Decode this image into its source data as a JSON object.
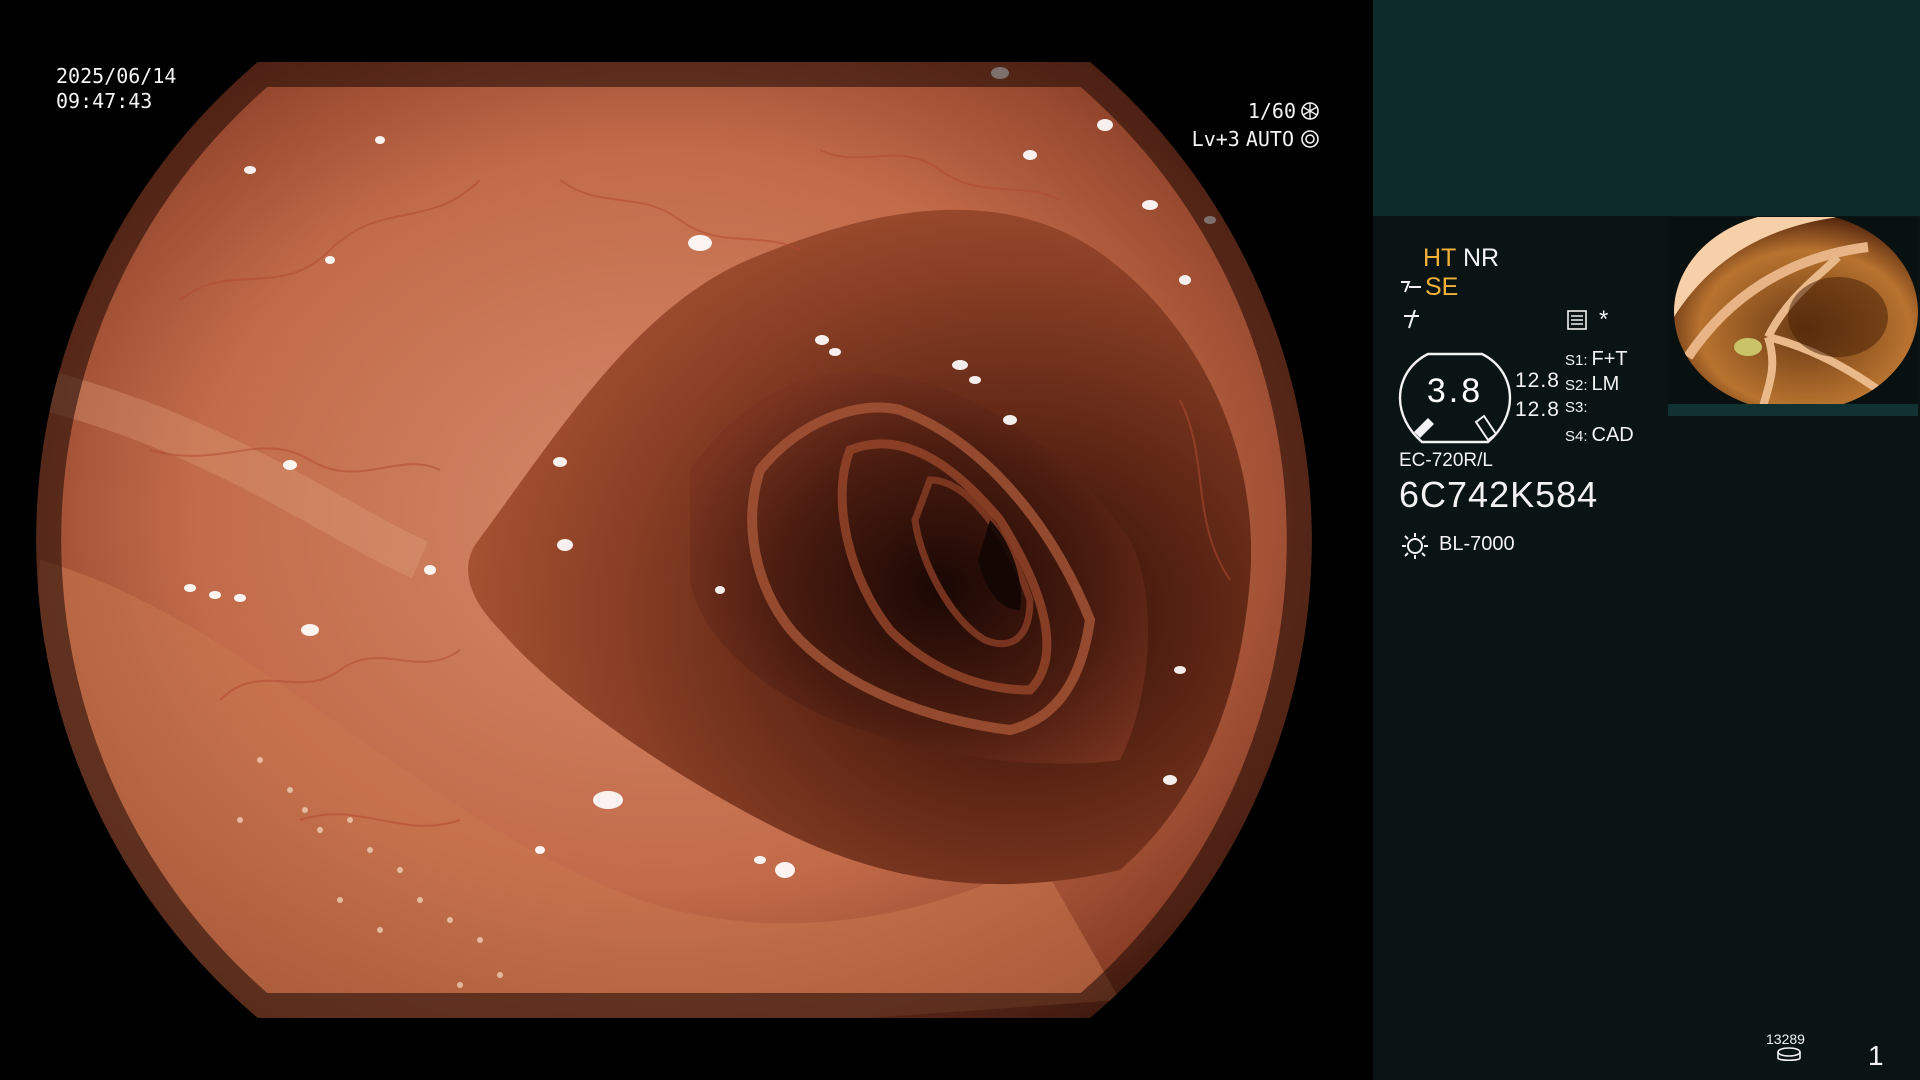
{
  "overlay": {
    "date": "2025/06/14",
    "time": "09:47:43",
    "shutter": "1/60",
    "level": "Lv+3",
    "auto": "AUTO"
  },
  "panel": {
    "mode_ht": "HT",
    "mode_nr": "NR",
    "mode_se": "SE",
    "asterisk": "*",
    "zoom": "3.8",
    "zoom_values": [
      "12.8",
      "12.8"
    ],
    "switches": [
      {
        "key": "S1:",
        "value": "F+T"
      },
      {
        "key": "S2:",
        "value": "LM"
      },
      {
        "key": "S3:",
        "value": ""
      },
      {
        "key": "S4:",
        "value": "CAD"
      }
    ],
    "scope_model": "EC-720R/L",
    "serial": "6C742K584",
    "light_source": "BL-7000",
    "image_count": "13289",
    "page_number": "1"
  },
  "colors": {
    "accent_orange": "#f2b23a",
    "panel_bg": "#0b1414",
    "panel_top_bg": "#0e2b2b"
  },
  "icons": [
    "shutter-icon",
    "auto-iris-icon",
    "structure-enhance-icon",
    "freeze-icon",
    "menu-icon",
    "zoom-gauge-icon",
    "light-source-icon",
    "disk-icon"
  ]
}
